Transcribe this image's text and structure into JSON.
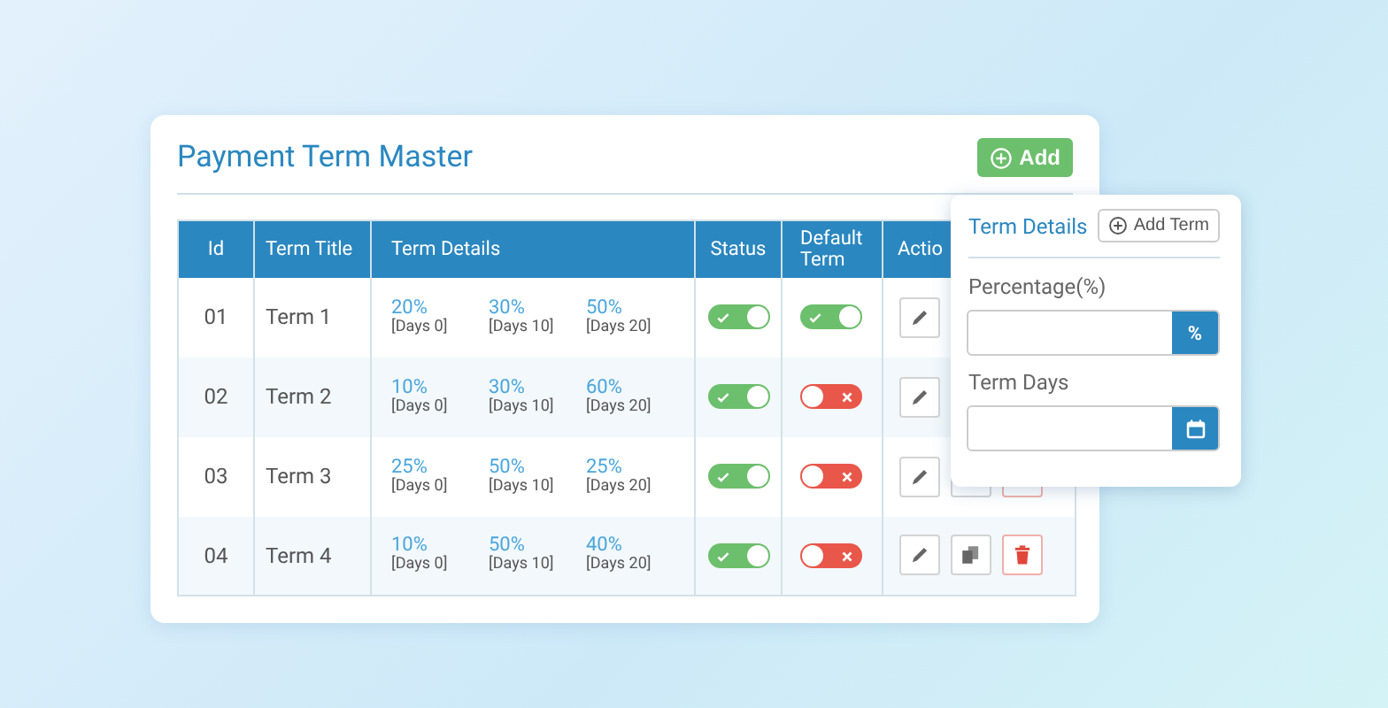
{
  "panel": {
    "title": "Payment Term Master",
    "add_button": "Add"
  },
  "table": {
    "columns": [
      "Id",
      "Term Title",
      "Term Details",
      "Status",
      "Default\nTerm",
      "Actio"
    ],
    "rows": [
      {
        "id": "01",
        "title": "Term 1",
        "details": [
          {
            "percent": "20%",
            "days": "[Days 0]"
          },
          {
            "percent": "30%",
            "days": "[Days 10]"
          },
          {
            "percent": "50%",
            "days": "[Days 20]"
          }
        ],
        "status_on": true,
        "default_on": true,
        "actions": [
          {
            "kind": "edit"
          }
        ]
      },
      {
        "id": "02",
        "title": "Term 2",
        "details": [
          {
            "percent": "10%",
            "days": "[Days 0]"
          },
          {
            "percent": "30%",
            "days": "[Days 10]"
          },
          {
            "percent": "60%",
            "days": "[Days 20]"
          }
        ],
        "status_on": true,
        "default_on": false,
        "actions": [
          {
            "kind": "edit"
          }
        ]
      },
      {
        "id": "03",
        "title": "Term 3",
        "details": [
          {
            "percent": "25%",
            "days": "[Days 0]"
          },
          {
            "percent": "50%",
            "days": "[Days 10]"
          },
          {
            "percent": "25%",
            "days": "[Days 20]"
          }
        ],
        "status_on": true,
        "default_on": false,
        "actions": [
          {
            "kind": "edit"
          },
          {
            "kind": "copy",
            "icon_covered": true
          },
          {
            "kind": "delete",
            "icon_covered": true
          }
        ]
      },
      {
        "id": "04",
        "title": "Term 4",
        "details": [
          {
            "percent": "10%",
            "days": "[Days 0]"
          },
          {
            "percent": "50%",
            "days": "[Days 10]"
          },
          {
            "percent": "40%",
            "days": "[Days 20]"
          }
        ],
        "status_on": true,
        "default_on": false,
        "actions": [
          {
            "kind": "edit"
          },
          {
            "kind": "copy"
          },
          {
            "kind": "delete"
          }
        ]
      }
    ]
  },
  "popup": {
    "title": "Term Details",
    "add_button": "Add Term",
    "fields": [
      {
        "label": "Percentage(%)",
        "kind": "percent",
        "addon_text": "%"
      },
      {
        "label": "Term Days",
        "kind": "calendar"
      }
    ]
  }
}
